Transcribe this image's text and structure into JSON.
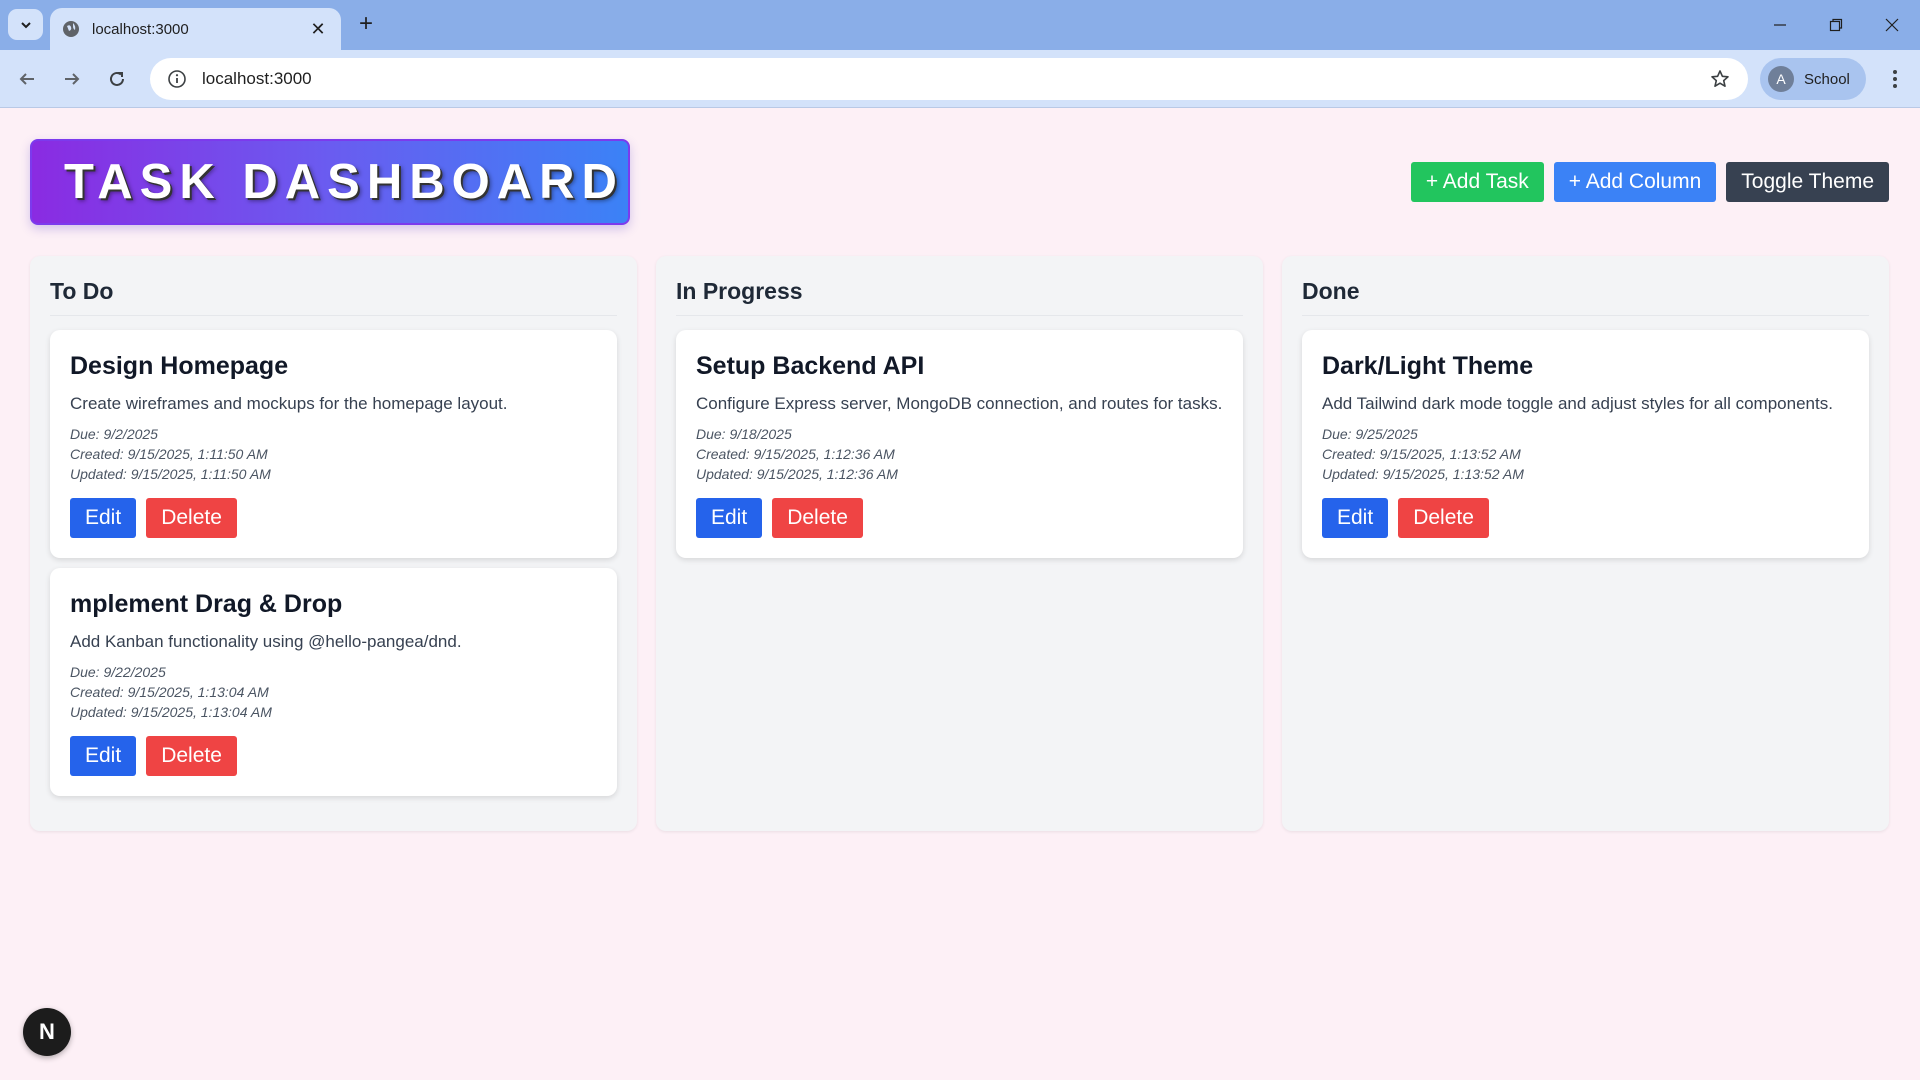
{
  "browser": {
    "tab_title": "localhost:3000",
    "url": "localhost:3000",
    "profile_initial": "A",
    "profile_name": "School"
  },
  "header": {
    "title": "TASK DASHBOARD",
    "add_task_label": "+ Add Task",
    "add_column_label": "+ Add Column",
    "toggle_theme_label": "Toggle Theme"
  },
  "columns": [
    {
      "title": "To Do",
      "cards": [
        {
          "title": "Design Homepage",
          "description": "Create wireframes and mockups for the homepage layout.",
          "due": "Due: 9/2/2025",
          "created": "Created: 9/15/2025, 1:11:50 AM",
          "updated": "Updated: 9/15/2025, 1:11:50 AM",
          "edit_label": "Edit",
          "delete_label": "Delete"
        },
        {
          "title": "mplement Drag & Drop",
          "description": "Add Kanban functionality using @hello-pangea/dnd.",
          "due": "Due: 9/22/2025",
          "created": "Created: 9/15/2025, 1:13:04 AM",
          "updated": "Updated: 9/15/2025, 1:13:04 AM",
          "edit_label": "Edit",
          "delete_label": "Delete"
        }
      ]
    },
    {
      "title": "In Progress",
      "cards": [
        {
          "title": "Setup Backend API",
          "description": "Configure Express server, MongoDB connection, and routes for tasks.",
          "due": "Due: 9/18/2025",
          "created": "Created: 9/15/2025, 1:12:36 AM",
          "updated": "Updated: 9/15/2025, 1:12:36 AM",
          "edit_label": "Edit",
          "delete_label": "Delete"
        }
      ]
    },
    {
      "title": "Done",
      "cards": [
        {
          "title": "Dark/Light Theme",
          "description": "Add Tailwind dark mode toggle and adjust styles for all components.",
          "due": "Due: 9/25/2025",
          "created": "Created: 9/15/2025, 1:13:52 AM",
          "updated": "Updated: 9/15/2025, 1:13:52 AM",
          "edit_label": "Edit",
          "delete_label": "Delete"
        }
      ]
    }
  ],
  "dev_badge": "N",
  "colors": {
    "page_bg": "#fdf0f6",
    "add_task": "#22c55e",
    "add_column": "#3b82f6",
    "toggle_theme": "#374151",
    "edit": "#2563eb",
    "delete": "#ef4444"
  }
}
